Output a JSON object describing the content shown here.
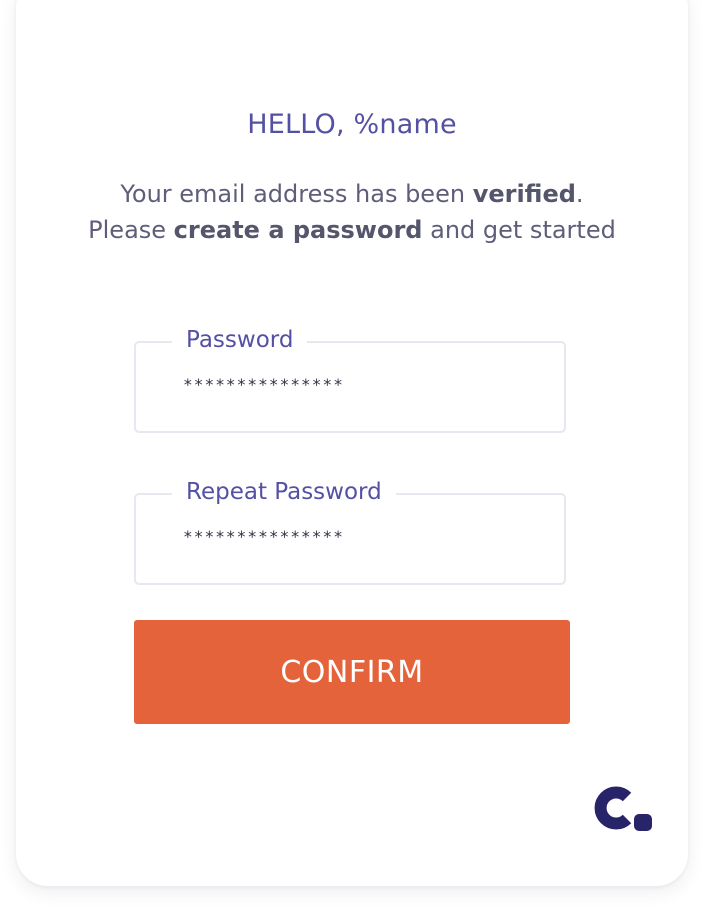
{
  "greeting": "HELLO, %name",
  "message": {
    "line1_prefix": "Your email address has been ",
    "line1_bold": "verified",
    "line1_suffix": ".",
    "line2_prefix": "Please ",
    "line2_bold": "create a password",
    "line2_suffix": " and get started"
  },
  "fields": {
    "password": {
      "label": "Password",
      "value": "***************"
    },
    "repeat_password": {
      "label": "Repeat Password",
      "value": "***************"
    }
  },
  "confirm_button": {
    "label": "CONFIRM"
  },
  "brand": {
    "logo_icon": "brand-c-logo-icon",
    "logo_color": "#28246a",
    "accent_color": "#e5633a",
    "label_color": "#5450a3"
  }
}
